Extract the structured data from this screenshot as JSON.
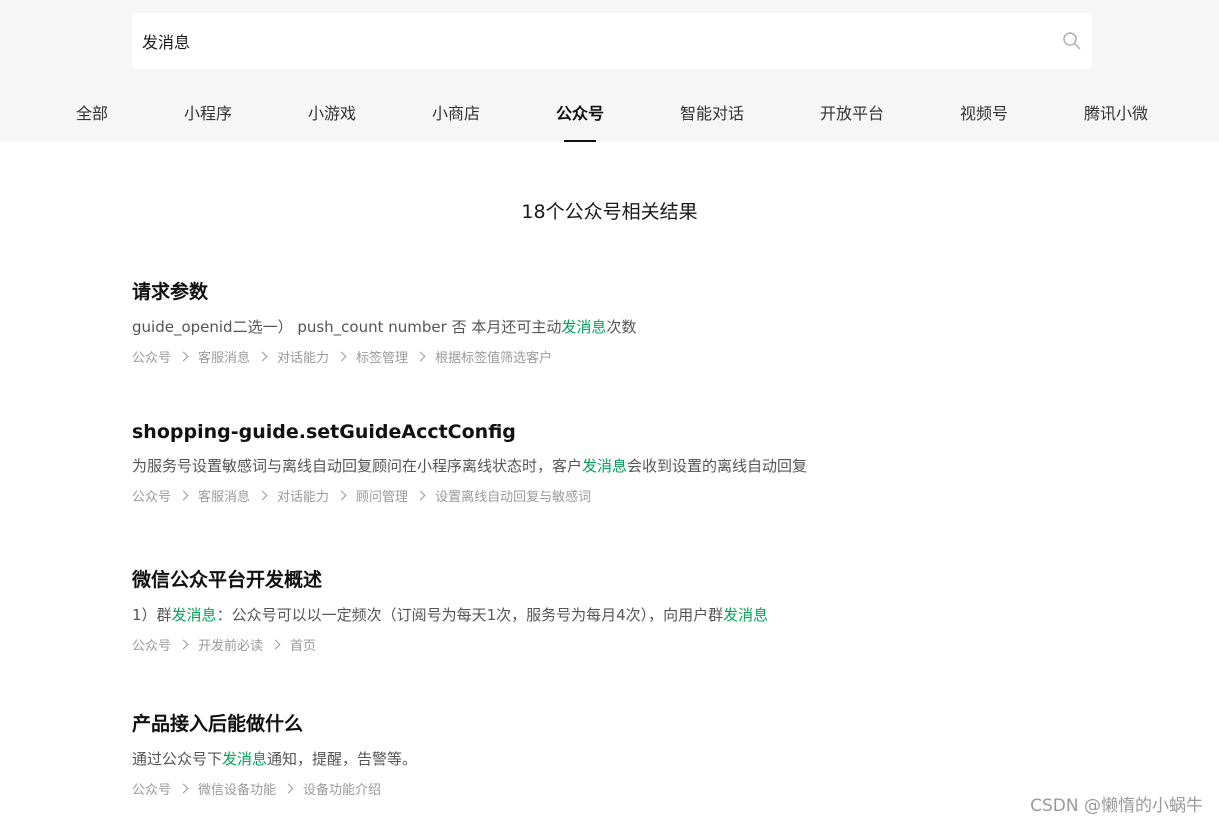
{
  "search": {
    "value": "发消息"
  },
  "tabs": [
    {
      "label": "全部"
    },
    {
      "label": "小程序"
    },
    {
      "label": "小游戏"
    },
    {
      "label": "小商店"
    },
    {
      "label": "公众号"
    },
    {
      "label": "智能对话"
    },
    {
      "label": "开放平台"
    },
    {
      "label": "视频号"
    },
    {
      "label": "腾讯小微"
    }
  ],
  "active_tab": "公众号",
  "result_count": "18个公众号相关结果",
  "highlight_color": "#07a15a",
  "results": [
    {
      "title": "请求参数",
      "desc": {
        "before": "guide_openid二选一） push_count number 否 本月还可主动",
        "keyword": "发消息",
        "after": "次数",
        "keyword2": ""
      },
      "crumbs": [
        "公众号",
        "客服消息",
        "对话能力",
        "标签管理",
        "根据标签值筛选客户"
      ]
    },
    {
      "title": "shopping-guide.setGuideAcctConfig",
      "desc": {
        "before": "为服务号设置敏感词与离线自动回复顾问在小程序离线状态时，客户",
        "keyword": "发消息",
        "after": "会收到设置的离线自动回复",
        "keyword2": ""
      },
      "crumbs": [
        "公众号",
        "客服消息",
        "对话能力",
        "顾问管理",
        "设置离线自动回复与敏感词"
      ]
    },
    {
      "title": "微信公众平台开发概述",
      "desc": {
        "before": "1）群",
        "keyword": "发消息",
        "after": "：公众号可以以一定频次（订阅号为每天1次，服务号为每月4次），向用户群",
        "keyword2": "发消息"
      },
      "crumbs": [
        "公众号",
        "开发前必读",
        "首页"
      ]
    },
    {
      "title": "产品接入后能做什么",
      "desc": {
        "before": "通过公众号下",
        "keyword": "发消息",
        "after": "通知，提醒，告警等。",
        "keyword2": ""
      },
      "crumbs": [
        "公众号",
        "微信设备功能",
        "设备功能介绍"
      ]
    }
  ],
  "watermark": "CSDN @懒惰的小蜗牛"
}
